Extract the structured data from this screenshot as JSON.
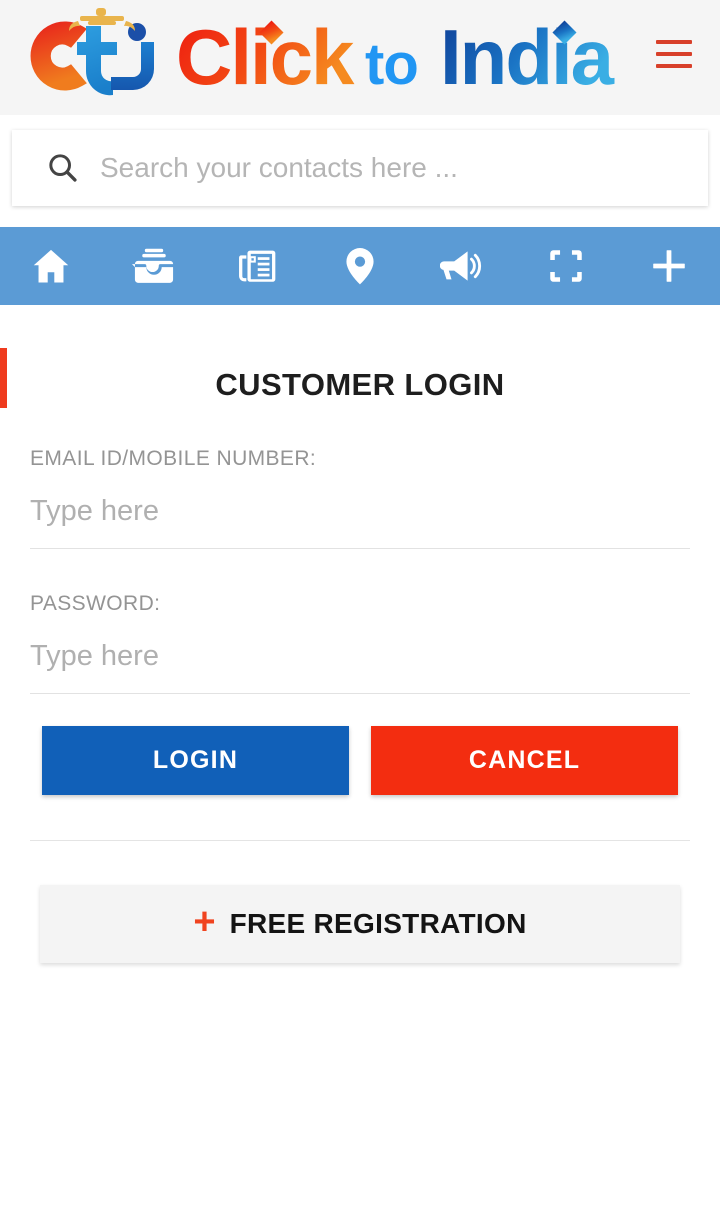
{
  "header": {
    "logo": {
      "mark_text": "Cti",
      "word1": "Click",
      "word2": "to",
      "word3": "India",
      "mark_c_color": "#ee3f22",
      "mark_t_color": "#1f8ed6",
      "mark_i_color": "#1b5fb8",
      "crown_color": "#e9b44c",
      "click_color_start": "#ee2211",
      "click_color_end": "#f38020",
      "to_color": "#2196f3",
      "india_color_start": "#10479e",
      "india_color_end": "#35a7e0"
    },
    "menu_icon": "hamburger-icon",
    "menu_color": "#d8402a",
    "background": "#f5f5f5"
  },
  "search": {
    "icon": "search-icon",
    "placeholder": "Search your contacts here ...",
    "value": ""
  },
  "navbar": {
    "background": "#5b9bd5",
    "items": [
      {
        "icon": "home-icon",
        "label": "Home"
      },
      {
        "icon": "inbox-icon",
        "label": "Inbox"
      },
      {
        "icon": "news-icon",
        "label": "News"
      },
      {
        "icon": "location-pin-icon",
        "label": "Location"
      },
      {
        "icon": "megaphone-icon",
        "label": "Announcements"
      },
      {
        "icon": "scan-frame-icon",
        "label": "Scan"
      },
      {
        "icon": "plus-icon",
        "label": "Add"
      }
    ]
  },
  "login": {
    "accent_color": "#ef3b1e",
    "title": "CUSTOMER LOGIN",
    "fields": [
      {
        "label": "EMAIL ID/MOBILE NUMBER:",
        "placeholder": "Type here",
        "value": ""
      },
      {
        "label": "PASSWORD:",
        "placeholder": "Type here",
        "value": ""
      }
    ],
    "buttons": {
      "login": {
        "label": "LOGIN",
        "color": "#1160b8"
      },
      "cancel": {
        "label": "CANCEL",
        "color": "#f32d10"
      }
    },
    "register": {
      "plus": "+",
      "label": "FREE REGISTRATION",
      "plus_color": "#f0431f",
      "background": "#f4f4f4"
    }
  }
}
